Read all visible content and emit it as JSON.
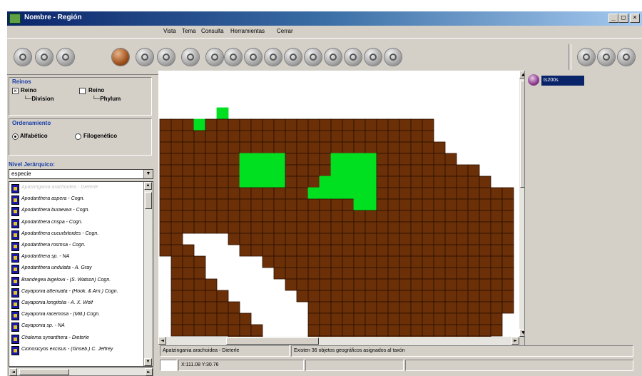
{
  "window": {
    "title": "Nombre - Región",
    "min": "_",
    "max": "□",
    "close": "×"
  },
  "menu": [
    "Vista",
    "Tema",
    "Consulta",
    "Herramientas",
    "Cerrar"
  ],
  "toolbar": {
    "left_icons": [
      "compass-icon",
      "stop-icon",
      "refresh-icon"
    ],
    "main_icons": [
      "brown-ball-icon",
      "print-icon",
      "save-icon",
      "globe-icon",
      "zoom-in-icon",
      "zoom-out-icon",
      "full-extent-icon",
      "pan-icon",
      "identify-icon",
      "table-icon",
      "measure-icon",
      "find-icon",
      "query-icon",
      "info-icon"
    ],
    "right_icons": [
      "layers-icon",
      "legend-icon",
      "help-icon"
    ]
  },
  "reinos": {
    "label": "Reinos",
    "opt1": "Reino",
    "opt1_sub": "Division",
    "opt1_checked": true,
    "opt2": "Reino",
    "opt2_sub": "Phylum",
    "opt2_checked": false
  },
  "ordenamiento": {
    "label": "Ordenamiento",
    "opt1": "Alfabético",
    "opt2": "Filogenético",
    "selected": "Alfabético"
  },
  "nivel": {
    "label": "Nivel Jerárquico:",
    "value": "especie"
  },
  "species": [
    "Apatzingania arachoidea - Dieterle",
    "Apodanthera aspera - Cogn.",
    "Apodanthera buraeavii - Cogn.",
    "Apodanthera crispa - Cogn.",
    "Apodanthera cucurbitoides - Cogn.",
    "Apodanthera rosmsa - Cogn.",
    "Apodanthera sp. - NA",
    "Apodanthera undulata - A. Gray",
    "Brandegea bigelovii - (S. Watson) Cogn.",
    "Cayaponia attenuata - (Hook. & Arn.) Cogn.",
    "Cayaponia longifolia - A. X. Wolf",
    "Cayaponia racemosa - (Mill.) Cogn.",
    "Cayaponia sp. - NA",
    "Chalema synanthera - Dieterle",
    "Cionosicyos excisus - (Griseb.) C. Jeffrey"
  ],
  "map": {
    "land_color": "#6b3008",
    "grid_color": "#2a1000",
    "highlight_color": "#00e020",
    "layer_label": "ts200s"
  },
  "status": {
    "taxon": "Apatzingania arachoidea - Dieterle",
    "message": "Existen 36 objetos geográficos asignados al taxón",
    "coords": "X:111.08 Y:30.76"
  }
}
